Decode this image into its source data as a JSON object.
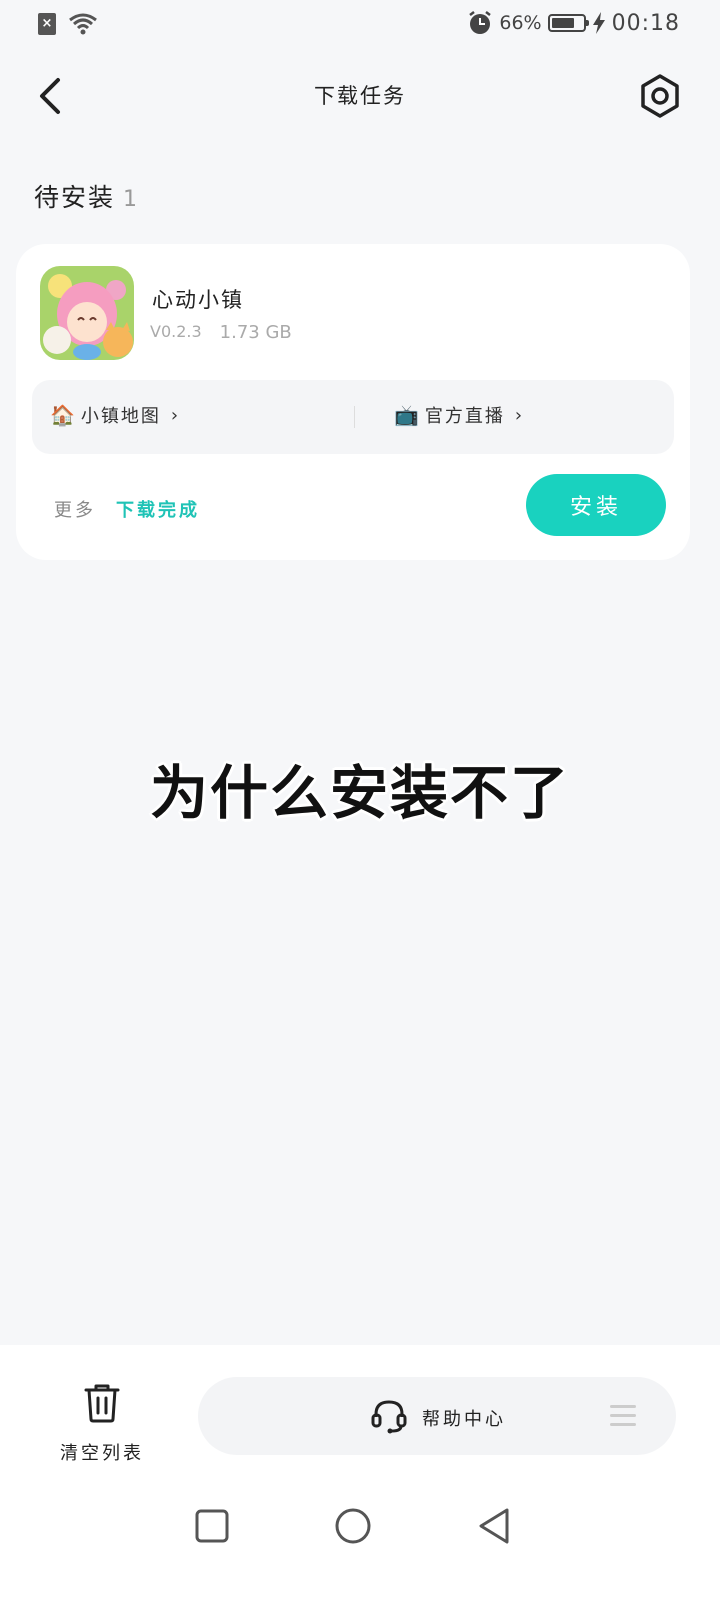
{
  "status_bar": {
    "sim_label": "×",
    "battery_percent_text": "66%",
    "battery_level": 0.66,
    "time": "00:18",
    "icons": [
      "sim-off-icon",
      "wifi-icon",
      "alarm-icon",
      "battery-icon",
      "charging-icon"
    ]
  },
  "nav": {
    "title": "下载任务",
    "back_icon": "back-arrow-icon",
    "settings_icon": "settings-icon"
  },
  "section": {
    "title": "待安装",
    "count": "1"
  },
  "task": {
    "app_name": "心动小镇",
    "version": "V0.2.3",
    "size": "1.73 GB",
    "links": [
      {
        "emoji": "🏠",
        "label": "小镇地图",
        "chevron": "›"
      },
      {
        "emoji": "📺",
        "label": "官方直播",
        "chevron": "›"
      }
    ],
    "more_label": "更多",
    "status_label": "下载完成",
    "install_label": "安装"
  },
  "caption": "为什么安装不了",
  "bottom": {
    "clear_label": "清空列表",
    "help_label": "帮助中心"
  },
  "colors": {
    "accent": "#19d2bf",
    "accent_text": "#1fc3b6",
    "background": "#f6f7f9"
  }
}
